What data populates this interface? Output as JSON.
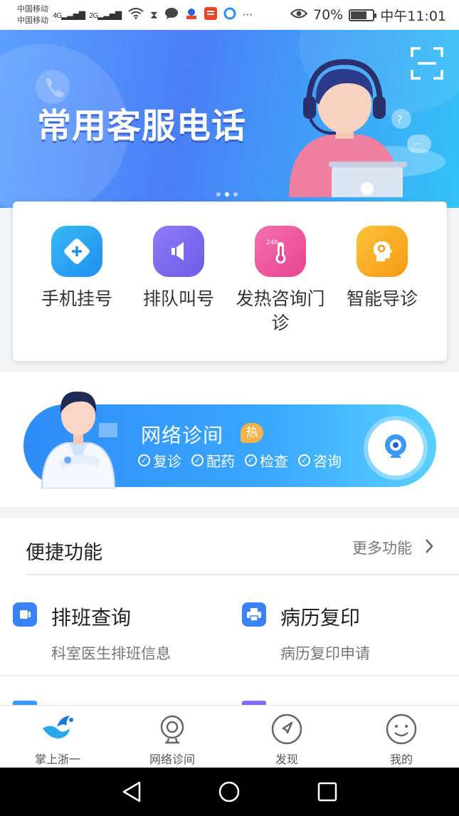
{
  "status_bar": {
    "carrier_1": "中国移动",
    "carrier_2": "中国移动",
    "net_1": "4G",
    "net_2": "2G",
    "battery": "70%",
    "time": "中午11:01"
  },
  "banner": {
    "title": "常用客服电话",
    "slide_count": 3,
    "active_slide": 2
  },
  "quick_actions": [
    {
      "label": "手机挂号",
      "icon": "hospital-card-icon",
      "color": "#29a6f3"
    },
    {
      "label": "排队叫号",
      "icon": "speaker-icon",
      "color": "#7f6df3"
    },
    {
      "label": "发热咨询门诊",
      "icon": "thermometer-icon",
      "color": "#f05ba0"
    },
    {
      "label": "智能导诊",
      "icon": "head-brain-icon",
      "color": "#f7a81b"
    }
  ],
  "consult": {
    "title": "网络诊间",
    "badge": "热",
    "tags": [
      "复诊",
      "配药",
      "检查",
      "咨询"
    ]
  },
  "features": {
    "title": "便捷功能",
    "more": "更多功能",
    "items": [
      {
        "title": "排班查询",
        "desc": "科室医生排班信息",
        "icon": "schedule-icon"
      },
      {
        "title": "病历复印",
        "desc": "病历复印申请",
        "icon": "printer-icon"
      }
    ]
  },
  "tabs": [
    {
      "label": "掌上浙一",
      "icon": "home-logo-icon",
      "active": true
    },
    {
      "label": "网络诊间",
      "icon": "webcam-icon",
      "active": false
    },
    {
      "label": "发现",
      "icon": "compass-icon",
      "active": false
    },
    {
      "label": "我的",
      "icon": "smiley-icon",
      "active": false
    }
  ],
  "colors": {
    "primary": "#3a82f6",
    "banner_start": "#5aa0ff",
    "banner_end": "#33c3f7"
  }
}
